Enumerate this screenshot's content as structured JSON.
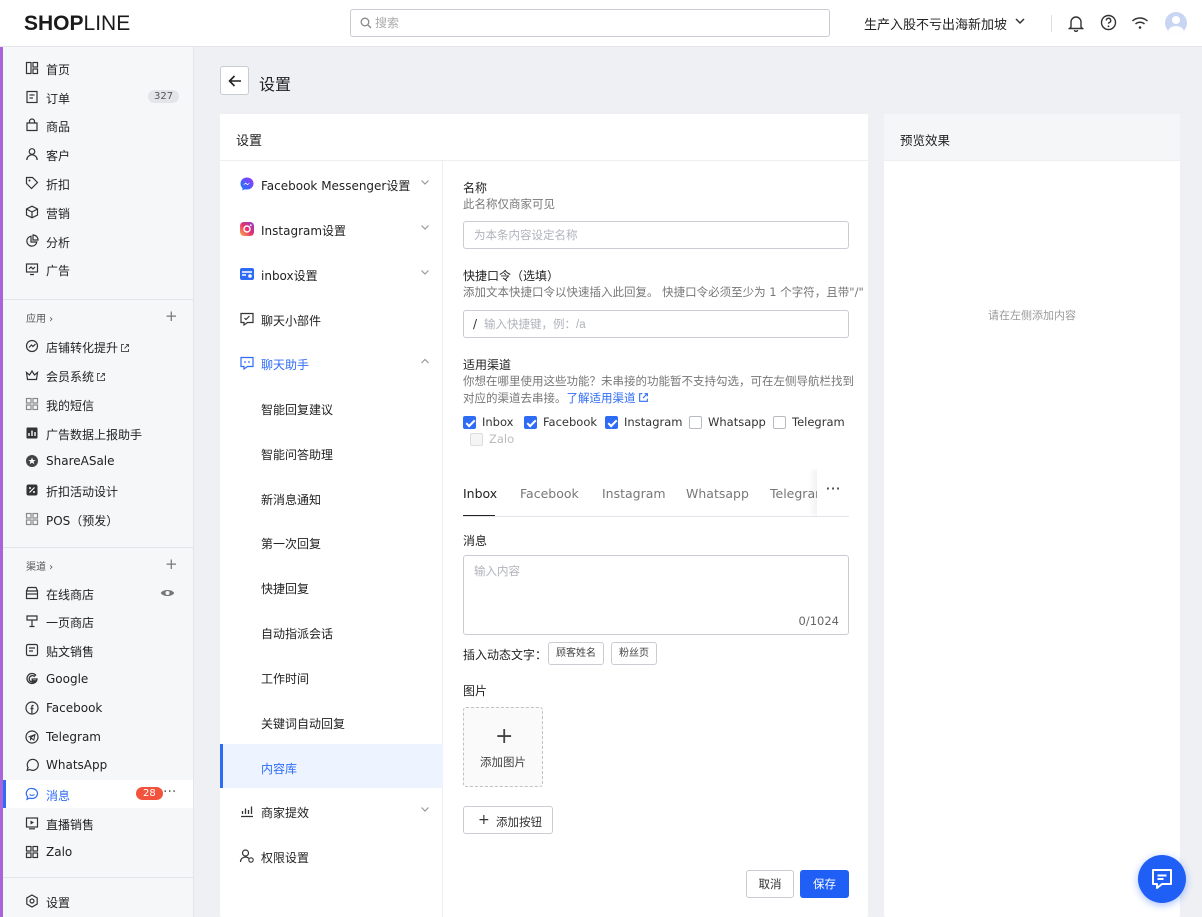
{
  "brand": {
    "logo_bold": "SHOP",
    "logo_light": "LINE"
  },
  "header": {
    "search_placeholder": "搜索",
    "store_name": "生产入股不亏出海新加坡",
    "accent": "#2f6cf6"
  },
  "sidebar": {
    "main_items": [
      {
        "label": "首页",
        "icon": "dashboard-icon"
      },
      {
        "label": "订单",
        "icon": "order-icon",
        "badge": "327"
      },
      {
        "label": "商品",
        "icon": "bag-icon"
      },
      {
        "label": "客户",
        "icon": "user-icon"
      },
      {
        "label": "折扣",
        "icon": "tag-icon"
      },
      {
        "label": "营销",
        "icon": "box-icon"
      },
      {
        "label": "分析",
        "icon": "pie-icon"
      },
      {
        "label": "广告",
        "icon": "ad-icon"
      }
    ],
    "apps_title": "应用",
    "apps": [
      {
        "label": "店铺转化提升",
        "icon": "boost-icon",
        "external": true
      },
      {
        "label": "会员系统",
        "icon": "crown-icon",
        "external": true
      },
      {
        "label": "我的短信",
        "icon": "sms-icon"
      },
      {
        "label": "广告数据上报助手",
        "icon": "report-icon"
      },
      {
        "label": "ShareASale",
        "icon": "sharesale-icon"
      },
      {
        "label": "折扣活动设计",
        "icon": "percent-icon"
      },
      {
        "label": "POS（预发）",
        "icon": "pos-icon"
      }
    ],
    "channels_title": "渠道",
    "channels": [
      {
        "label": "在线商店",
        "icon": "store-icon"
      },
      {
        "label": "一页商店",
        "icon": "onepage-icon"
      },
      {
        "label": "贴文销售",
        "icon": "post-icon"
      },
      {
        "label": "Google",
        "icon": "google-icon"
      },
      {
        "label": "Facebook",
        "icon": "facebook-icon"
      },
      {
        "label": "Telegram",
        "icon": "telegram-icon"
      },
      {
        "label": "WhatsApp",
        "icon": "whatsapp-icon"
      },
      {
        "label": "消息",
        "icon": "message-icon",
        "badge": "28",
        "active": true
      },
      {
        "label": "直播销售",
        "icon": "live-icon"
      },
      {
        "label": "Zalo",
        "icon": "zalo-icon"
      }
    ],
    "settings_label": "设置"
  },
  "page": {
    "title": "设置"
  },
  "settings_card": {
    "title": "设置",
    "menu": [
      {
        "label": "Facebook Messenger设置",
        "icon": "messenger-icon",
        "chevron": "down"
      },
      {
        "label": "Instagram设置",
        "icon": "instagram-icon",
        "chevron": "down"
      },
      {
        "label": "inbox设置",
        "icon": "inbox-icon",
        "chevron": "down"
      },
      {
        "label": "聊天小部件",
        "icon": "widget-icon"
      },
      {
        "label": "聊天助手",
        "icon": "assistant-icon",
        "chevron": "up",
        "open": true
      },
      {
        "label": "智能回复建议",
        "sub": true
      },
      {
        "label": "智能问答助理",
        "sub": true
      },
      {
        "label": "新消息通知",
        "sub": true
      },
      {
        "label": "第一次回复",
        "sub": true
      },
      {
        "label": "快捷回复",
        "sub": true
      },
      {
        "label": "自动指派会话",
        "sub": true
      },
      {
        "label": "工作时间",
        "sub": true
      },
      {
        "label": "关键词自动回复",
        "sub": true
      },
      {
        "label": "内容库",
        "sub": true,
        "active": true
      },
      {
        "label": "商家提效",
        "icon": "chart-icon",
        "chevron": "down"
      },
      {
        "label": "权限设置",
        "icon": "permission-icon"
      }
    ]
  },
  "form": {
    "name_label": "名称",
    "name_help": "此名称仅商家可见",
    "name_placeholder": "为本条内容设定名称",
    "shortcut_label": "快捷口令（选填）",
    "shortcut_help": "添加文本快捷口令以快速插入此回复。 快捷口令必须至少为 1 个字符，且带\"/\"",
    "shortcut_prefix": "/",
    "shortcut_placeholder": "输入快捷键，例：/a",
    "channels_label": "适用渠道",
    "channels_help_1": "你想在哪里使用这些功能？未串接的功能暂不支持勾选，可在左侧导航栏找到",
    "channels_help_2": "对应的渠道去串接。",
    "channels_link": "了解适用渠道",
    "channel_options": [
      {
        "label": "Inbox",
        "checked": true
      },
      {
        "label": "Facebook",
        "checked": true
      },
      {
        "label": "Instagram",
        "checked": true
      },
      {
        "label": "Whatsapp",
        "checked": false
      },
      {
        "label": "Telegram",
        "checked": false
      },
      {
        "label": "Zalo",
        "checked": false,
        "disabled": true
      }
    ],
    "tabs": [
      "Inbox",
      "Facebook",
      "Instagram",
      "Whatsapp",
      "Telegram"
    ],
    "tabs_more": "···",
    "message_label": "消息",
    "message_placeholder": "输入内容",
    "message_count": "0/1024",
    "dynamic_label": "插入动态文字：",
    "dynamic_tags": [
      "顾客姓名",
      "粉丝页"
    ],
    "image_label": "图片",
    "add_image": "添加图片",
    "add_button": "添加按钮",
    "cancel": "取消",
    "save": "保存"
  },
  "preview": {
    "title": "预览效果",
    "empty": "请在左侧添加内容"
  }
}
